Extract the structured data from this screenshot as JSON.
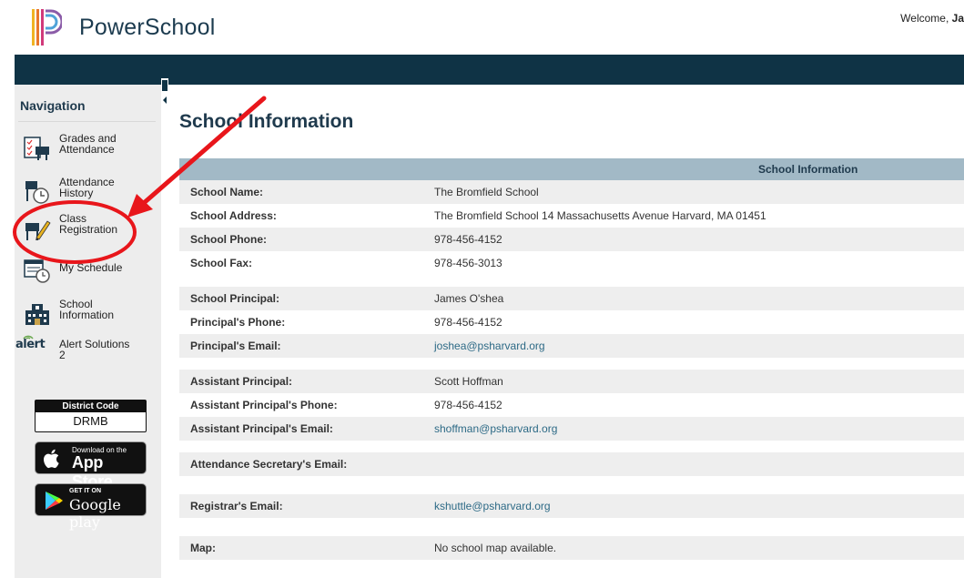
{
  "header": {
    "brand": "PowerSchool",
    "welcome_prefix": "Welcome, ",
    "welcome_name": "Ja"
  },
  "sidebar": {
    "title": "Navigation",
    "items": [
      {
        "label": "Grades and\nAttendance",
        "icon": "grades-icon"
      },
      {
        "label": "Attendance\nHistory",
        "icon": "attendance-history-icon"
      },
      {
        "label": "Class\nRegistration",
        "icon": "class-registration-icon"
      },
      {
        "label": "My Schedule",
        "icon": "schedule-icon"
      },
      {
        "label": "School\nInformation",
        "icon": "school-icon"
      },
      {
        "label": "Alert Solutions\n2",
        "icon": "alert-solutions-icon"
      }
    ],
    "alert_logo_text": "alert",
    "district": {
      "label": "District Code",
      "code": "DRMB"
    },
    "app_store": {
      "small": "Download on the",
      "big": "App Store"
    },
    "google_play": {
      "small": "GET IT ON",
      "big": "Google play"
    }
  },
  "main": {
    "title": "School Information",
    "table_header": "School Information",
    "groups": [
      [
        {
          "key": "School Name:",
          "value": "The Bromfield School"
        },
        {
          "key": "School Address:",
          "value": "The Bromfield School 14 Massachusetts Avenue Harvard, MA 01451"
        },
        {
          "key": "School Phone:",
          "value": "978-456-4152"
        },
        {
          "key": "School Fax:",
          "value": "978-456-3013"
        }
      ],
      [
        {
          "key": "School Principal:",
          "value": "James O'shea"
        },
        {
          "key": "Principal's Phone:",
          "value": "978-456-4152"
        },
        {
          "key": "Principal's Email:",
          "value": "joshea@psharvard.org",
          "link": true
        }
      ],
      [
        {
          "key": "Assistant Principal:",
          "value": "Scott Hoffman"
        },
        {
          "key": "Assistant Principal's Phone:",
          "value": "978-456-4152"
        },
        {
          "key": "Assistant Principal's Email:",
          "value": "shoffman@psharvard.org",
          "link": true
        }
      ],
      [
        {
          "key": "Attendance Secretary's Email:",
          "value": ""
        }
      ],
      [
        {
          "key": "Registrar's Email:",
          "value": "kshuttle@psharvard.org",
          "link": true
        }
      ],
      [
        {
          "key": "Map:",
          "value": "No school map available."
        }
      ]
    ]
  },
  "colors": {
    "topbar": "#0f3345",
    "table_header": "#a2b9c6",
    "link": "#2d6a86",
    "annotation": "#e8161b"
  }
}
